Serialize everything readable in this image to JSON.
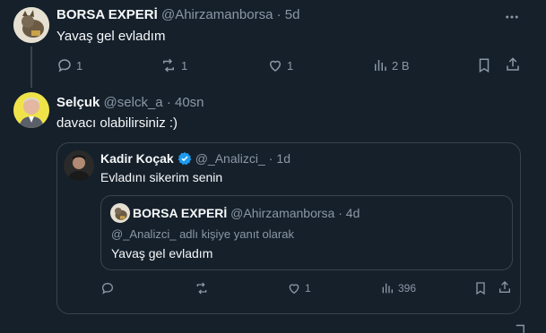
{
  "tweet1": {
    "name": "BORSA EXPERİ",
    "handle": "@Ahirzamanborsa",
    "time": "5d",
    "text": "Yavaş gel evladım",
    "replies": "1",
    "retweets": "1",
    "likes": "1",
    "views": "2 B",
    "more_icon": "more-icon"
  },
  "tweet2": {
    "name": "Selçuk",
    "handle": "@selck_a",
    "time": "40sn",
    "text": "davacı olabilirsiniz :)"
  },
  "quote": {
    "name": "Kadir Koçak",
    "handle": "@_Analizci_",
    "time": "1d",
    "text": "Evladını sikerim senin",
    "verified_color": "#1d9bf0",
    "inner": {
      "name": "BORSA EXPERİ",
      "handle": "@Ahirzamanborsa",
      "time": "4d",
      "reply_to": "@_Analizci_ adlı kişiye yanıt olarak",
      "text": "Yavaş gel evladım"
    },
    "likes": "1",
    "views": "396"
  }
}
